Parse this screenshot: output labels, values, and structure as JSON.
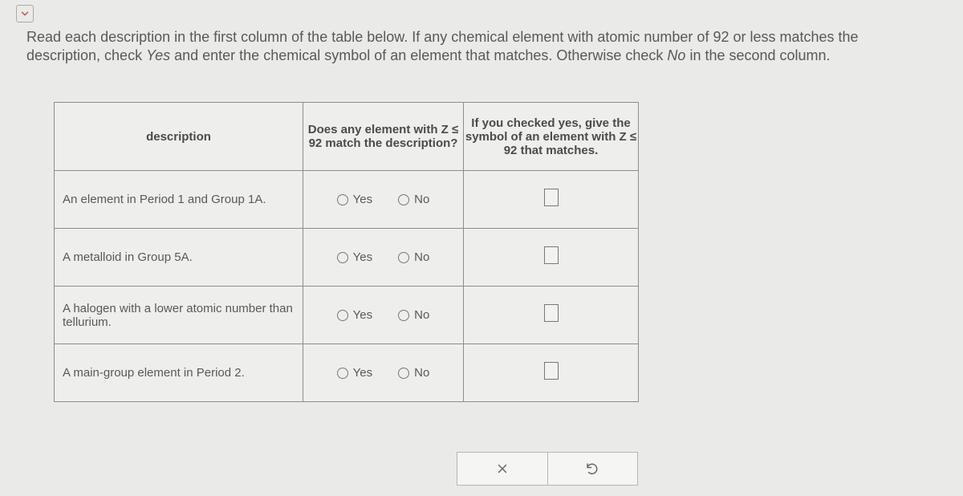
{
  "instructions": {
    "part1": "Read each description in the first column of the table below. If any chemical element with atomic number of 92 or less matches the description, check ",
    "yes": "Yes",
    "part2": " and enter the chemical symbol of an element that matches. Otherwise check ",
    "no": "No",
    "part3": " in the second column."
  },
  "headers": {
    "description": "description",
    "match": "Does any element with Z ≤ 92 match the description?",
    "symbol": "If you checked yes, give the symbol of an element with Z ≤ 92 that matches."
  },
  "radio_labels": {
    "yes": "Yes",
    "no": "No"
  },
  "rows": [
    {
      "description": "An element in Period 1 and Group 1A."
    },
    {
      "description": "A metalloid in Group 5A."
    },
    {
      "description": "A halogen with a lower atomic number than tellurium."
    },
    {
      "description": "A main-group element in Period 2."
    }
  ]
}
